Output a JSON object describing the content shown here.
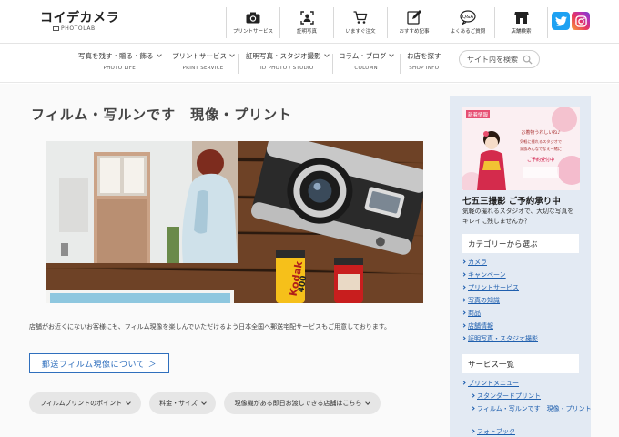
{
  "header": {
    "logo_text": "コイデカメラ",
    "logo_sub": "PHOTOLAB",
    "icon_nav": [
      {
        "label": "プリントサービス",
        "icon": "camera-icon"
      },
      {
        "label": "証明写真",
        "icon": "id-photo-icon"
      },
      {
        "label": "いますぐ注文",
        "icon": "cart-icon"
      },
      {
        "label": "おすすめ記事",
        "icon": "pencil-icon"
      },
      {
        "label": "よくあるご質問",
        "icon": "faq-icon"
      },
      {
        "label": "店舗検索",
        "icon": "store-icon"
      }
    ],
    "sns": [
      {
        "name": "twitter",
        "icon": "twitter-icon",
        "color": "#1da1f2"
      },
      {
        "name": "instagram",
        "icon": "instagram-icon",
        "color": "#e1306c"
      }
    ]
  },
  "category_nav": {
    "items": [
      {
        "jp": "写真を残す・贈る・飾る",
        "en": "PHOTO LIFE",
        "has_dropdown": true
      },
      {
        "jp": "プリントサービス",
        "en": "PRINT SERVICE",
        "has_dropdown": true
      },
      {
        "jp": "証明写真・スタジオ撮影",
        "en": "ID PHOTO / STUDIO",
        "has_dropdown": true
      },
      {
        "jp": "コラム・ブログ",
        "en": "COLUMN",
        "has_dropdown": true
      },
      {
        "jp": "お店を探す",
        "en": "SHOP INFO",
        "has_dropdown": false
      }
    ],
    "search_placeholder": "サイト内を検索"
  },
  "main": {
    "title": "フィルム・写ルンです　現像・プリント",
    "hero_labels": {
      "film_brand": "Kodak",
      "film_iso": "400"
    },
    "description": "店舗がお近くにないお客様にも、フィルム現像を楽しんでいただけるよう日本全国へ郵送宅配サービスもご用意しております。",
    "cta_label": "郵送フィルム現像について ＞",
    "pills": [
      {
        "label": "フィルムプリントのポイント"
      },
      {
        "label": "料金・サイズ"
      },
      {
        "label": "現像機がある即日お渡しできる店舗はこちら"
      }
    ]
  },
  "sidebar": {
    "promo": {
      "badge": "新着情報",
      "image_text_1": "お着物うれしいね♪",
      "image_text_2": "気軽に撮れるスタジオで",
      "image_text_3": "家族みんなでなえー緒に",
      "image_text_4": "ご予約受付中",
      "title": "七五三撮影 ご予約承り中",
      "desc": "気軽の撮れるスタジオで、大切な写真をキレイに残しませんか？"
    },
    "category_heading": "カテゴリーから選ぶ",
    "categories": [
      "カメラ",
      "キャンペーン",
      "プリントサービス",
      "写真の知識",
      "商品",
      "店舗情報",
      "証明写真・スタジオ撮影"
    ],
    "service_heading": "サービス一覧",
    "services": [
      {
        "label": "プリントメニュー",
        "level": 0
      },
      {
        "label": "スタンダードプリント",
        "level": 1
      },
      {
        "label": "フィルム・写ルンです　現像・プリント",
        "level": 1
      },
      {
        "label": "フォトブック",
        "level": 1
      }
    ]
  }
}
